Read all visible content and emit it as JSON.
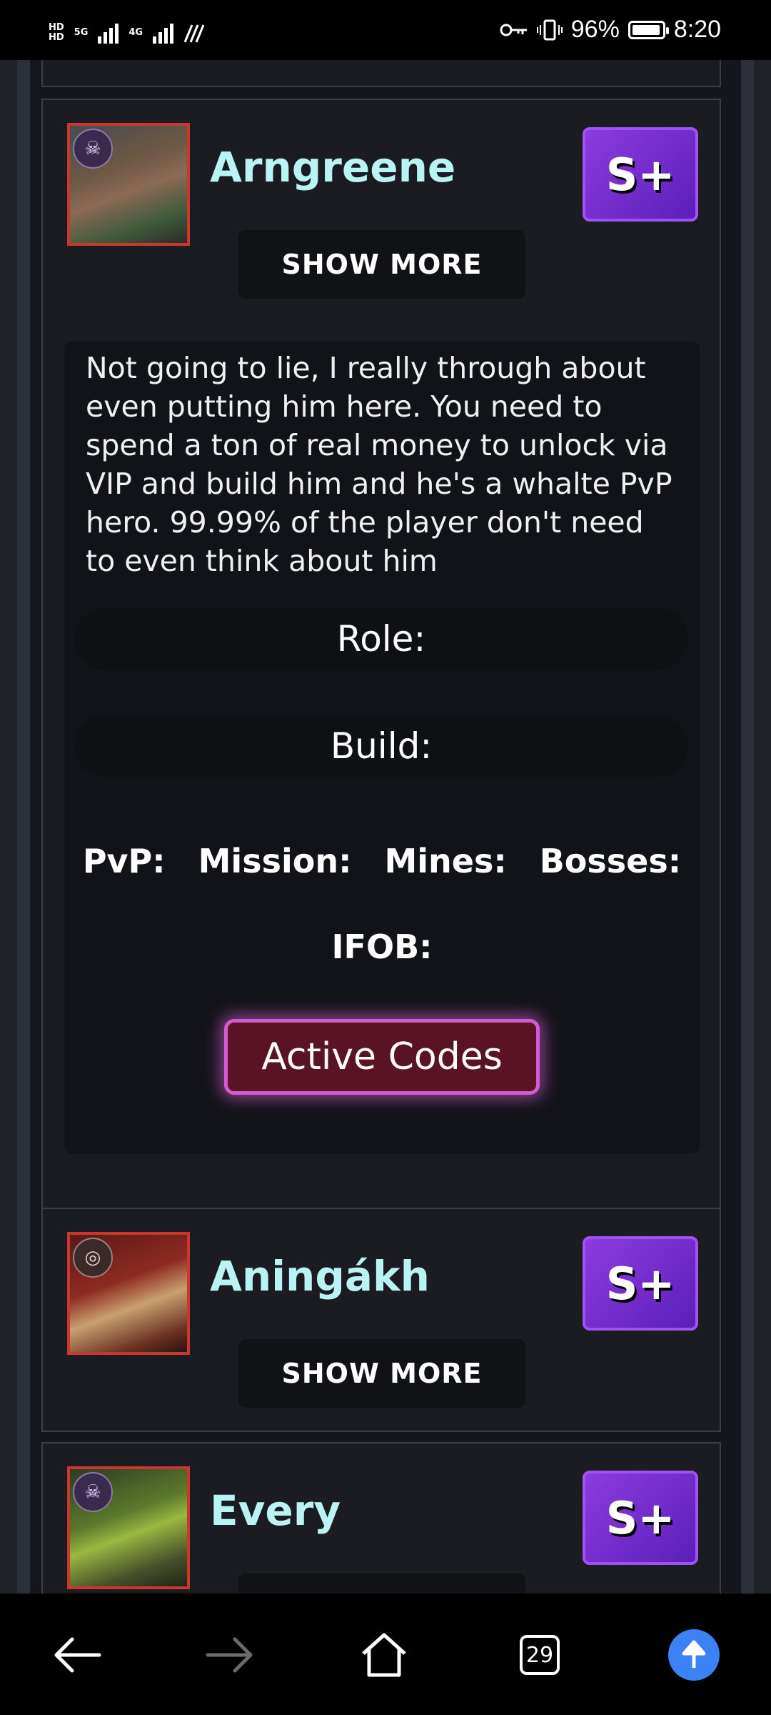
{
  "status_bar": {
    "hd_top": "HD",
    "hd_bottom": "HD",
    "net1": "5G",
    "net2": "4G",
    "battery_percent": "96%",
    "time": "8:20",
    "battery_level": 0.96
  },
  "heroes": [
    {
      "name": "Arngreene",
      "tier": "S+",
      "show_more_label": "SHOW MORE",
      "badge_icon": "skull-icon",
      "expanded": true,
      "description": "Not going to lie, I really through about even putting him here. You need to spend a ton of real money to unlock via VIP and build him and he's a whalte PvP hero. 99.99% of the player don't need to even think about him",
      "role_label": "Role:",
      "build_label": "Build:",
      "stats": {
        "pvp": "PvP:",
        "mission": "Mission:",
        "mines": "Mines:",
        "bosses": "Bosses:",
        "ifob": "IFOB:"
      },
      "active_codes_label": "Active Codes"
    },
    {
      "name": "Aningákh",
      "tier": "S+",
      "show_more_label": "SHOW MORE",
      "badge_icon": "target-icon"
    },
    {
      "name": "Every",
      "tier": "S+",
      "badge_icon": "skull-icon"
    }
  ],
  "nav": {
    "tab_count": "29",
    "icons": [
      "back-arrow-icon",
      "forward-arrow-icon",
      "home-icon",
      "tabs-icon",
      "scroll-up-icon"
    ]
  }
}
